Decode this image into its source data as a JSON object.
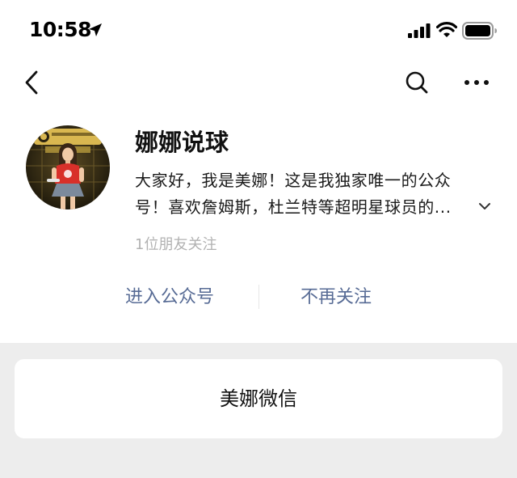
{
  "status_bar": {
    "time": "10:58",
    "icons": [
      "location-arrow-icon",
      "cellular-signal-icon",
      "wifi-icon",
      "battery-icon"
    ]
  },
  "nav": {
    "icons": [
      "chevron-left-icon",
      "search-icon",
      "more-icon"
    ]
  },
  "profile": {
    "name": "娜娜说球",
    "description_lines": [
      "大家好，我是美娜！这是我独家唯一的公众",
      "号！喜欢詹姆斯，杜兰特等超明星球员的..."
    ],
    "followers": "1位朋友关注"
  },
  "actions": {
    "enter": "进入公众号",
    "unfollow": "不再关注"
  },
  "card": {
    "label": "美娜微信"
  },
  "colors": {
    "link": "#576b95",
    "muted": "#b2b2b2",
    "background": "#ededed",
    "surface": "#ffffff"
  }
}
